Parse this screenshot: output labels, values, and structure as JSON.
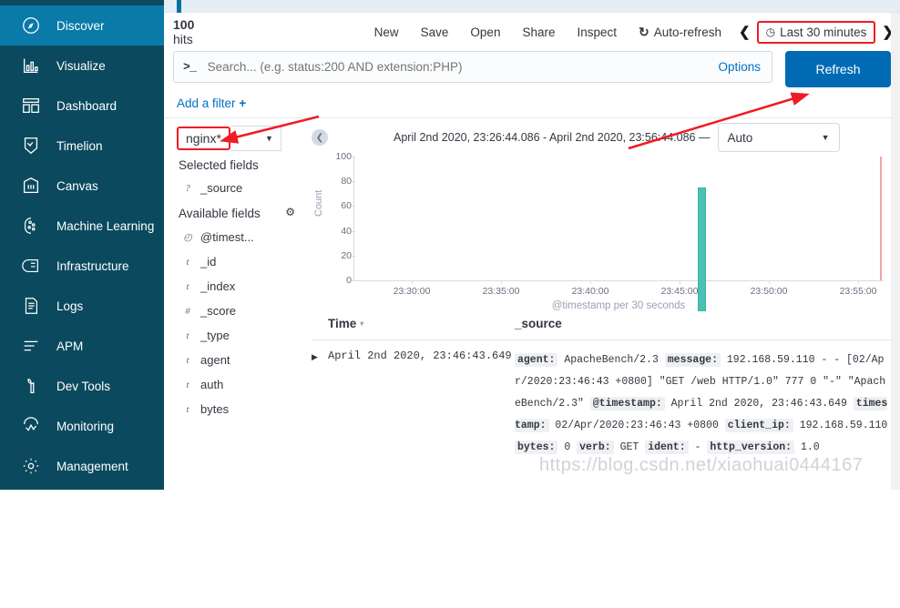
{
  "sidebar": {
    "items": [
      {
        "label": "Discover",
        "icon": "compass-icon",
        "active": true
      },
      {
        "label": "Visualize",
        "icon": "bar-chart-icon",
        "active": false
      },
      {
        "label": "Dashboard",
        "icon": "dashboard-icon",
        "active": false
      },
      {
        "label": "Timelion",
        "icon": "timelion-icon",
        "active": false
      },
      {
        "label": "Canvas",
        "icon": "canvas-icon",
        "active": false
      },
      {
        "label": "Machine Learning",
        "icon": "machine-learning-icon",
        "active": false
      },
      {
        "label": "Infrastructure",
        "icon": "infrastructure-icon",
        "active": false
      },
      {
        "label": "Logs",
        "icon": "logs-icon",
        "active": false
      },
      {
        "label": "APM",
        "icon": "apm-icon",
        "active": false
      },
      {
        "label": "Dev Tools",
        "icon": "wrench-icon",
        "active": false
      },
      {
        "label": "Monitoring",
        "icon": "monitoring-icon",
        "active": false
      },
      {
        "label": "Management",
        "icon": "gear-icon",
        "active": false
      }
    ]
  },
  "topbar": {
    "hits_count": "100",
    "hits_label": "hits",
    "actions": [
      "New",
      "Save",
      "Open",
      "Share",
      "Inspect"
    ],
    "auto_refresh_label": "Auto-refresh",
    "prev_label": "❮",
    "next_label": "❯",
    "time_range_label": "Last 30 minutes",
    "clock_icon": "clock-icon"
  },
  "search": {
    "prompt": ">_",
    "value": "",
    "placeholder": "Search... (e.g. status:200 AND extension:PHP)",
    "options_label": "Options",
    "refresh_label": "Refresh"
  },
  "filters": {
    "add_filter_label": "Add a filter",
    "plus": "+"
  },
  "fields_panel": {
    "index_pattern": "nginx*",
    "selected_fields_title": "Selected fields",
    "available_fields_title": "Available fields",
    "gear_icon": "gear-icon",
    "selected": [
      {
        "type": "?",
        "name": "_source"
      }
    ],
    "available": [
      {
        "type": "◴",
        "name": "@timest..."
      },
      {
        "type": "t",
        "name": "_id"
      },
      {
        "type": "t",
        "name": "_index"
      },
      {
        "type": "#",
        "name": "_score"
      },
      {
        "type": "t",
        "name": "_type"
      },
      {
        "type": "t",
        "name": "agent"
      },
      {
        "type": "t",
        "name": "auth"
      },
      {
        "type": "t",
        "name": "bytes"
      }
    ]
  },
  "chart_header": {
    "collapse_icon": "collapse-left-icon",
    "time_range_text": "April 2nd 2020, 23:26:44.086 - April 2nd 2020, 23:56:44.086 —",
    "interval_value": "Auto"
  },
  "chart_data": {
    "type": "bar",
    "title": "",
    "xlabel": "@timestamp per 30 seconds",
    "ylabel": "Count",
    "ylim": [
      0,
      100
    ],
    "yticks": [
      0,
      20,
      40,
      60,
      80,
      100
    ],
    "xticks": [
      "23:30:00",
      "23:35:00",
      "23:40:00",
      "23:45:00",
      "23:50:00",
      "23:55:00"
    ],
    "x_range": [
      "23:26:44",
      "23:56:44"
    ],
    "bar_color": "#4dc0b5",
    "now_marker_color": "#f3a3a3",
    "grid": false,
    "legend": "none",
    "x": [
      "23:46:30"
    ],
    "values": [
      100
    ],
    "bars": [
      {
        "time": "23:46:30",
        "count": 100
      }
    ],
    "now_marker_time": "23:56:44"
  },
  "doc_table": {
    "columns": [
      "Time",
      "_source"
    ],
    "sort_caret": "▾",
    "rows": [
      {
        "expand_icon": "expand-row-icon",
        "time": "April 2nd 2020, 23:46:43.649",
        "source_pairs": [
          {
            "key": "agent:",
            "value": "ApacheBench/2.3"
          },
          {
            "key": "message:",
            "value": "192.168.59.110 - - [02/Apr/2020:23:46:43 +0800] \"GET /web HTTP/1.0\" 777 0 \"-\" \"ApacheBench/2.3\""
          },
          {
            "key": "@timestamp:",
            "value": "April 2nd 2020, 23:46:43.649"
          },
          {
            "key": "timestamp:",
            "value": "02/Apr/2020:23:46:43 +0800"
          },
          {
            "key": "client_ip:",
            "value": "192.168.59.110"
          },
          {
            "key": "bytes:",
            "value": "0"
          },
          {
            "key": "verb:",
            "value": "GET"
          },
          {
            "key": "ident:",
            "value": "-"
          },
          {
            "key": "http_version:",
            "value": "1.0"
          }
        ]
      }
    ]
  },
  "annotations": {
    "highlight_color": "#ee1c25",
    "arrow_color": "#ee1c25",
    "watermark": "https://blog.csdn.net/xiaohuai0444167"
  }
}
